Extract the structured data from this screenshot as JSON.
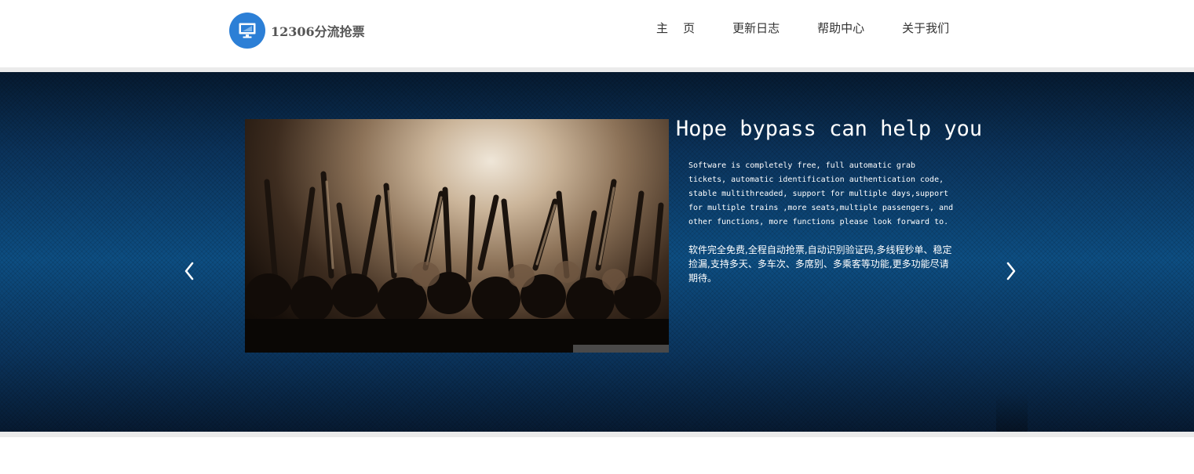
{
  "header": {
    "title": "12306分流抢票",
    "logo_icon": "monitor-icon",
    "nav": [
      {
        "label": "主    页"
      },
      {
        "label": "更新日志"
      },
      {
        "label": "帮助中心"
      },
      {
        "label": "关于我们"
      }
    ]
  },
  "hero": {
    "headline": "Hope bypass can help you",
    "description_en": "Software is completely free, full automatic grab tickets, automatic identification authentication code, stable multithreaded, support for multiple days,support for multiple trains ,more seats,multiple passengers, and other functions, more functions please look forward to.",
    "description_zh": "软件完全免费,全程自动抢票,自动识别验证码,多线程秒单、稳定捡漏,支持多天、多车次、多席别、多乘客等功能,更多功能尽请期待。",
    "prev_icon": "chevron-left-icon",
    "next_icon": "chevron-right-icon",
    "image": "concert-crowd-photo"
  },
  "colors": {
    "accent": "#2c7fd6",
    "hero_mid": "#0d4e82",
    "hero_dark": "#061a30",
    "band": "#ebebeb"
  }
}
